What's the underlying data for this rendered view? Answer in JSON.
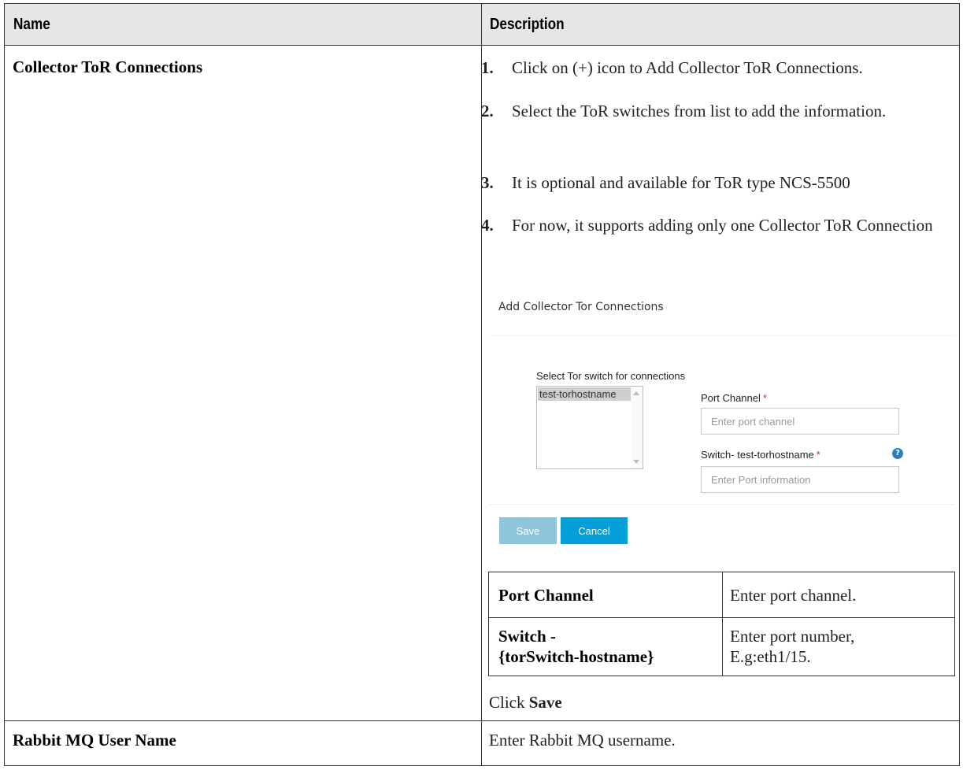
{
  "header": {
    "name": "Name",
    "description": "Description"
  },
  "row1": {
    "name": "Collector ToR Connections",
    "steps": [
      {
        "num": "1.",
        "text": "Click on (+) icon to Add Collector ToR Connections."
      },
      {
        "num": "2.",
        "text": "Select the ToR switches from list to add the information."
      },
      {
        "num": "3.",
        "text": "It is optional and available for ToR type NCS-5500"
      },
      {
        "num": "4.",
        "text": "For now, it supports adding only one Collector ToR Connection"
      }
    ],
    "screenshot": {
      "title": "Add Collector Tor Connections",
      "select_label": "Select Tor switch for connections",
      "list_option": "test-torhostname",
      "port_channel_label": "Port Channel",
      "port_channel_placeholder": "Enter port channel",
      "switch_label": "Switch- test-torhostname",
      "switch_placeholder": "Enter Port information",
      "required_mark": "*",
      "help_glyph": "?",
      "save_label": "Save",
      "cancel_label": "Cancel"
    },
    "inner_table": {
      "r1c1": "Port Channel",
      "r1c2": "Enter port channel.",
      "r2c1_line1": "Switch -",
      "r2c1_line2": "{torSwitch-hostname}",
      "r2c2_line1": "Enter port number,",
      "r2c2_line2": "E.g:eth1/15."
    },
    "click_prefix": "Click ",
    "click_bold": "Save"
  },
  "row2": {
    "name": "Rabbit MQ User Name",
    "description": "Enter Rabbit MQ username."
  },
  "colors": {
    "header_bg": "#e6e6e6",
    "cancel_button": "#049fd9",
    "save_button_disabled": "#8fc5dc",
    "required": "#d9232f",
    "help_icon": "#2c7fb8"
  }
}
